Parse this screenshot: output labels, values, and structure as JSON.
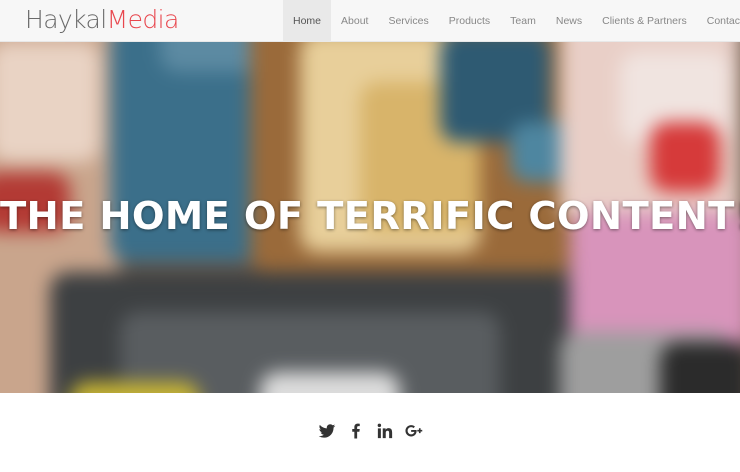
{
  "header": {
    "logo": {
      "part1": "Haykal",
      "part2": "Media"
    },
    "nav": [
      {
        "label": "Home",
        "active": true
      },
      {
        "label": "About",
        "active": false
      },
      {
        "label": "Services",
        "active": false
      },
      {
        "label": "Products",
        "active": false
      },
      {
        "label": "Team",
        "active": false
      },
      {
        "label": "News",
        "active": false
      },
      {
        "label": "Clients & Partners",
        "active": false
      },
      {
        "label": "Contact",
        "active": false
      }
    ]
  },
  "hero": {
    "title": "THE HOME OF TERRIFIC CONTENT!"
  },
  "social": {
    "icons": [
      "twitter-icon",
      "facebook-icon",
      "linkedin-icon",
      "google-plus-icon"
    ]
  },
  "colors": {
    "brand_gray": "#6a6a6a",
    "brand_red": "#e8464d",
    "nav_text": "#888888",
    "nav_active_bg": "#e9e9e9",
    "icon_color": "#333333"
  }
}
